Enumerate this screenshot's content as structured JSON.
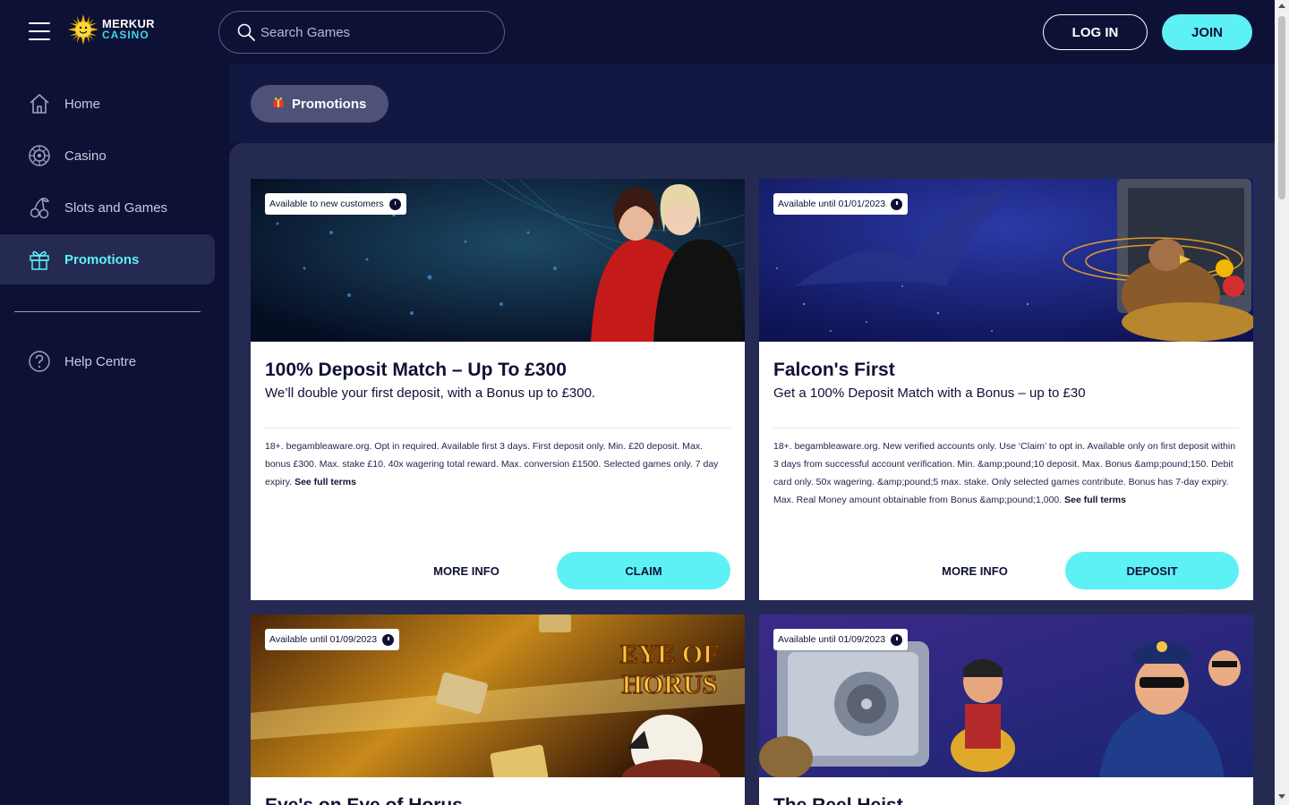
{
  "header": {
    "logo_line1": "MERKUR",
    "logo_line2": "CASINO",
    "search_placeholder": "Search Games",
    "login_label": "LOG IN",
    "join_label": "JOIN"
  },
  "sidebar": {
    "items": [
      {
        "label": "Home",
        "icon": "home-icon"
      },
      {
        "label": "Casino",
        "icon": "roulette-icon"
      },
      {
        "label": "Slots and Games",
        "icon": "cherries-icon"
      },
      {
        "label": "Promotions",
        "icon": "gift-icon",
        "active": true
      },
      {
        "label": "Help Centre",
        "icon": "help-icon"
      }
    ]
  },
  "main": {
    "chip_label": "Promotions",
    "cards": [
      {
        "badge": "Available to new customers",
        "title": "100% Deposit Match – Up To £300",
        "subtitle": "We’ll double your first deposit, with a Bonus up to £300.",
        "terms": "18+. begambleaware.org. Opt in required. Available first 3 days. First deposit only. Min. £20 deposit. Max. bonus £300. Max. stake £10. 40x wagering total reward. Max. conversion £1500. Selected games only. 7 day expiry.",
        "terms_link": "See full terms",
        "more_label": "MORE INFO",
        "cta_label": "CLAIM"
      },
      {
        "badge": "Available until 01/01/2023",
        "title": "Falcon's First",
        "subtitle": "Get a 100% Deposit Match with a Bonus – up to £30",
        "terms": "18+. begambleaware.org. New verified accounts only. Use ‘Claim’ to opt in. Available only on first deposit within 3 days from successful account verification. Min. &amp;pound;10 deposit. Max. Bonus &amp;pound;150. Debit card only. 50x wagering. &amp;pound;5 max. stake. Only selected games contribute. Bonus has 7-day expiry. Max. Real Money amount obtainable from Bonus &amp;pound;1,000.",
        "terms_link": "See full terms",
        "more_label": "MORE INFO",
        "cta_label": "DEPOSIT"
      },
      {
        "badge": "Available until 01/09/2023",
        "title": "Eye's on Eye of Horus",
        "banner_text_1": "EYE OF",
        "banner_text_2": "HORUS"
      },
      {
        "badge": "Available until 01/09/2023",
        "title": "The Reel Heist"
      }
    ]
  },
  "colors": {
    "background": "#0e1136",
    "panel": "#252a52",
    "accent": "#5df1f5"
  }
}
